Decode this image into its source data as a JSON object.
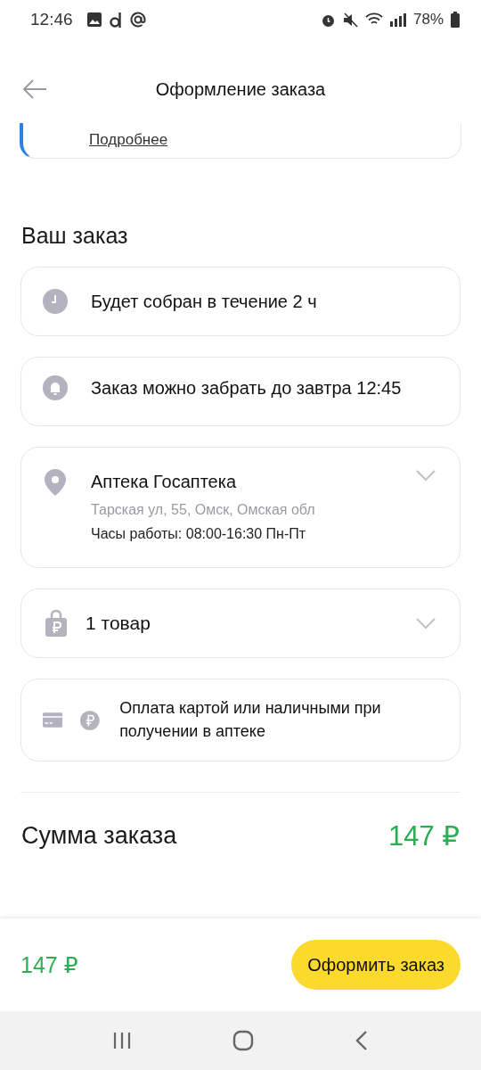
{
  "status_bar": {
    "time": "12:46",
    "battery": "78%"
  },
  "header": {
    "title": "Оформление заказа"
  },
  "top_card": {
    "link": "Подробнее"
  },
  "section_title": "Ваш заказ",
  "cards": [
    {
      "kind": "time",
      "title": "Будет собран в течение 2 ч"
    },
    {
      "kind": "deadline",
      "title": "Заказ можно забрать до завтра 12:45"
    },
    {
      "kind": "pharmacy",
      "title": "Аптека Госаптека",
      "address": "Тарская ул, 55, Омск, Омская обл",
      "hours": "Часы работы: 08:00-16:30 Пн-Пт",
      "expanded": false
    },
    {
      "kind": "items",
      "title": "1 товар",
      "expanded": false
    },
    {
      "kind": "payment",
      "title": "Оплата картой или наличными при получении в аптеке"
    }
  ],
  "summary": {
    "label": "Сумма заказа",
    "amount": "147 ₽"
  },
  "bottom_bar": {
    "amount": "147 ₽",
    "button": "Оформить заказ"
  }
}
